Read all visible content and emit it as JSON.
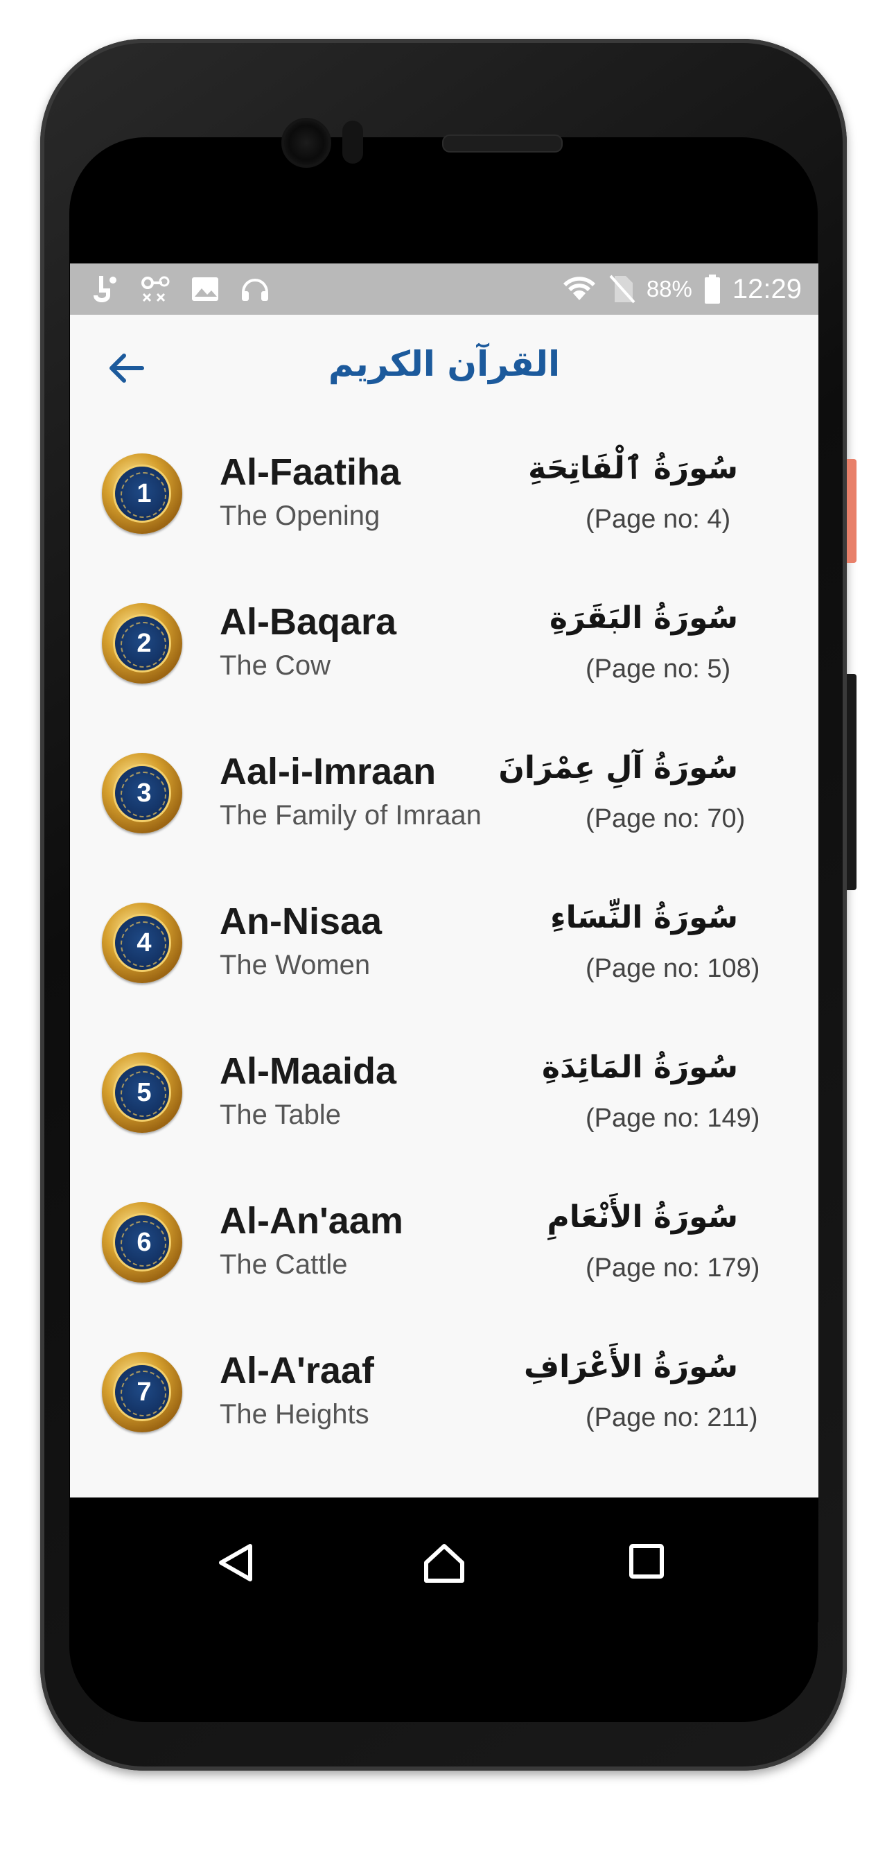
{
  "status_bar": {
    "battery_percent": "88%",
    "time": "12:29",
    "icons": [
      "usb-debug-icon",
      "voicemail-icon",
      "image-icon",
      "headset-icon",
      "wifi-icon",
      "no-sim-icon",
      "battery-icon"
    ]
  },
  "app_bar": {
    "title": "القرآن الكريم",
    "back_icon": "arrow-left-icon"
  },
  "surahs": [
    {
      "number": "1",
      "name": "Al-Faatiha",
      "meaning": "The Opening",
      "arabic": "سُورَةُ ٱلْفَاتِحَةِ",
      "page": "(Page no: 4)"
    },
    {
      "number": "2",
      "name": "Al-Baqara",
      "meaning": "The Cow",
      "arabic": "سُورَةُ البَقَرَةِ",
      "page": "(Page no: 5)"
    },
    {
      "number": "3",
      "name": "Aal-i-Imraan",
      "meaning": "The Family of Imraan",
      "arabic": "سُورَةُ آلِ عِمْرَانَ",
      "page": "(Page no: 70)"
    },
    {
      "number": "4",
      "name": "An-Nisaa",
      "meaning": "The Women",
      "arabic": "سُورَةُ النِّسَاءِ",
      "page": "(Page no: 108)"
    },
    {
      "number": "5",
      "name": "Al-Maaida",
      "meaning": "The Table",
      "arabic": "سُورَةُ المَائِدَةِ",
      "page": "(Page no: 149)"
    },
    {
      "number": "6",
      "name": "Al-An'aam",
      "meaning": "The Cattle",
      "arabic": "سُورَةُ الأَنْعَامِ",
      "page": "(Page no: 179)"
    },
    {
      "number": "7",
      "name": "Al-A'raaf",
      "meaning": "The Heights",
      "arabic": "سُورَةُ الأَعْرَافِ",
      "page": "(Page no: 211)"
    }
  ],
  "nav_bar": {
    "icons": [
      "back-triangle-icon",
      "home-icon",
      "recents-square-icon"
    ]
  },
  "colors": {
    "title": "#1c5a9c",
    "status_bar_bg": "#b9b9b9",
    "screen_bg": "#f8f8f8"
  }
}
